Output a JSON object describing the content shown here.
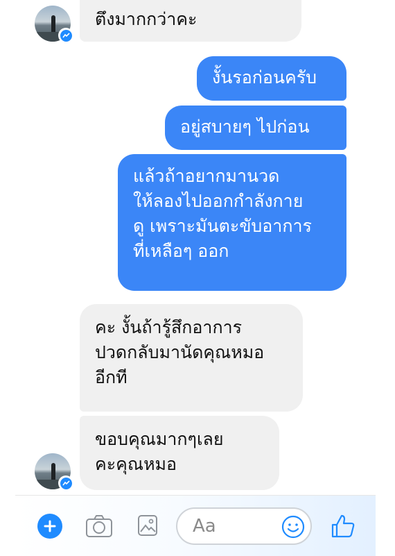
{
  "conversation": {
    "messages": [
      {
        "from": "them",
        "text": "ตึงมากกว่าคะ"
      },
      {
        "from": "me",
        "text": "งั้นรอก่อนครับ"
      },
      {
        "from": "me",
        "text": "อยู่สบายๆ ไปก่อน"
      },
      {
        "from": "me",
        "text": "แล้วถ้าอยากมานวด\nให้ลองไปออกกำลังกาย\nดู เพราะมันตะขับอาการ\nที่เหลือๆ ออก"
      },
      {
        "from": "them",
        "text": "คะ งั้นถ้ารู้สึกอาการ\nปวดกลับมานัดคุณหมอ\nอีกที"
      },
      {
        "from": "them",
        "text": "ขอบคุณมากๆเลย\nคะคุณหมอ"
      }
    ]
  },
  "composer": {
    "placeholder": "Aa",
    "icons": [
      "plus-icon",
      "camera-icon",
      "image-icon",
      "emoji-icon",
      "thumbs-up-icon"
    ]
  },
  "colors": {
    "outgoing_bubble": "#3b86f7",
    "incoming_bubble": "#f0f0f0",
    "accent": "#1f8bff"
  }
}
